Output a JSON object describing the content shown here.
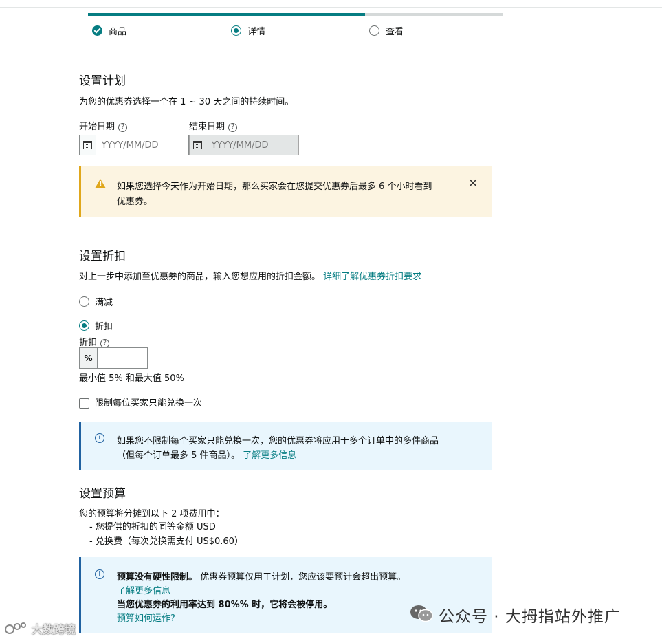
{
  "stepper": {
    "steps": [
      {
        "label": "商品",
        "state": "done"
      },
      {
        "label": "详情",
        "state": "current"
      },
      {
        "label": "查看",
        "state": "todo"
      }
    ],
    "progress_percent": 66.7
  },
  "schedule": {
    "title": "设置计划",
    "desc": "为您的优惠券选择一个在 1 ~ 30 天之间的持续时间。",
    "start_label": "开始日期",
    "end_label": "结束日期",
    "start_placeholder": "YYYY/MM/DD",
    "end_placeholder": "YYYY/MM/DD"
  },
  "warning": {
    "line1": "如果您选择今天作为开始日期，那么买家会在您提交优惠券后最多 6 个小时看到",
    "line2": "优惠券。"
  },
  "discount": {
    "title": "设置折扣",
    "desc": "对上一步中添加至优惠券的商品，输入您想应用的折扣金额。",
    "desc_link": "详细了解优惠券折扣要求",
    "option_amount": "满减",
    "option_percent": "折扣",
    "selected": "折扣",
    "field_label": "折扣",
    "unit": "%",
    "value": "",
    "hint": "最小值 5% 和最大值 50%",
    "once_label": "限制每位买家只能兑换一次",
    "once_checked": false
  },
  "info1": {
    "line1": "如果您不限制每个买家只能兑换一次，您的优惠券将应用于多个订单中的多件商品",
    "line2": "（但每个订单最多 5 件商品）。",
    "link": "了解更多信息"
  },
  "budget": {
    "title": "设置预算",
    "intro": "您的预算将分摊到以下 2 项费用中：",
    "items": [
      "- 您提供的折扣的同等金额 USD",
      "- 兑换费（每次兑换需支付 US$0.60）"
    ]
  },
  "info2": {
    "bold1": "预算没有硬性限制。",
    "text1": "优惠券预算仅用于计划，您应该要预计会超出预算。",
    "link1": "了解更多信息",
    "bold2": "当您优惠券的利用率达到 80%% 时，它将会被停用。",
    "link2": "预算如何运作?"
  },
  "watermark": {
    "right": "公众号 · 大拇指站外推广",
    "left": "大数跨境"
  },
  "colors": {
    "accent": "#067d82",
    "warn_bg": "#fcf4e1",
    "warn_border": "#e0a71b",
    "info_bg": "#e9f6fd",
    "info_border": "#2162a1"
  }
}
